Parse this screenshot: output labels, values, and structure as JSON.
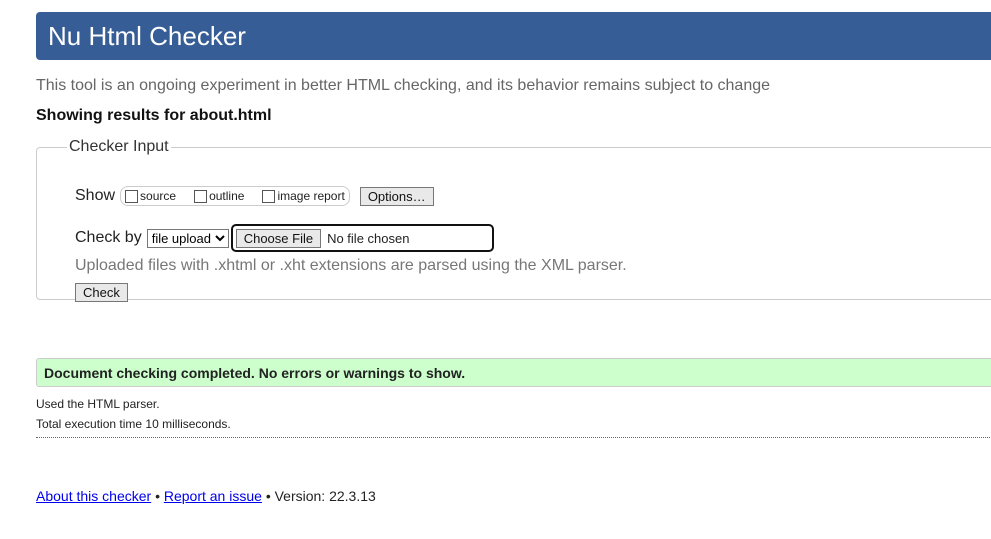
{
  "header": {
    "title": "Nu Html Checker"
  },
  "intro": "This tool is an ongoing experiment in better HTML checking, and its behavior remains subject to change",
  "showing": "Showing results for about.html",
  "form": {
    "legend": "Checker Input",
    "show_label": "Show",
    "show_options": [
      {
        "label": "source",
        "checked": false
      },
      {
        "label": "outline",
        "checked": false
      },
      {
        "label": "image report",
        "checked": false
      }
    ],
    "options_button": "Options…",
    "check_by_label": "Check by",
    "check_by_value": "file upload",
    "choose_file": "Choose File",
    "no_file": "No file chosen",
    "note": "Uploaded files with .xhtml or .xht extensions are parsed using the XML parser.",
    "check_button": "Check"
  },
  "result": {
    "message": "Document checking completed. No errors or warnings to show.",
    "parser": "Used the HTML parser.",
    "time": "Total execution time 10 milliseconds."
  },
  "footer": {
    "about": "About this checker",
    "sep": "•",
    "report": "Report an issue",
    "version": "• Version: 22.3.13"
  }
}
